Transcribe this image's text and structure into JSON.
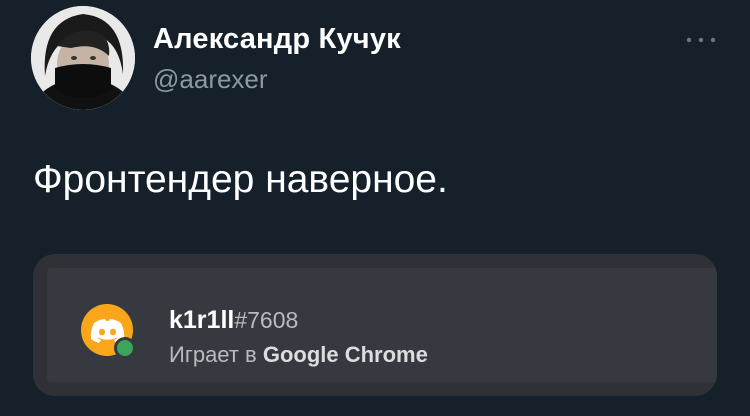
{
  "author": {
    "display_name": "Александр Кучук",
    "handle": "@aarexer",
    "avatar": "profile-photo"
  },
  "tweet": {
    "text": "Фронтендер наверное.",
    "more_icon": "more-horizontal-icon"
  },
  "attachment": {
    "type": "discord-presence-screenshot",
    "username": "k1r1ll",
    "discriminator": "#7608",
    "activity_prefix": "Играет в",
    "activity_app": "Google Chrome",
    "avatar_icon": "discord-logo-icon",
    "status_icon": "online-status-icon",
    "colors": {
      "avatar_bg": "#faa61a",
      "status_online": "#3ba55c",
      "card_bg": "#36393f"
    }
  },
  "colors": {
    "background": "#15202b",
    "secondary_text": "#8b98a5"
  }
}
